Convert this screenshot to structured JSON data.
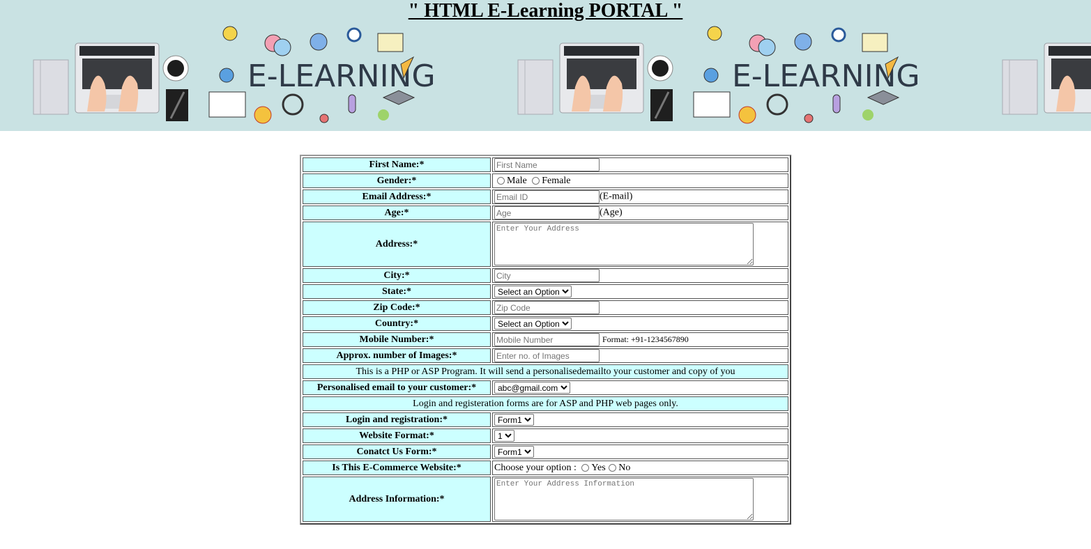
{
  "page": {
    "title": "\" HTML E-Learning PORTAL \"",
    "banner_text": "E-LEARNING"
  },
  "form": {
    "first_name": {
      "label": "First Name:*",
      "placeholder": "First Name"
    },
    "gender": {
      "label": "Gender:*",
      "options": [
        "Male",
        "Female"
      ]
    },
    "email": {
      "label": "Email Address:*",
      "placeholder": "Email ID",
      "hint": "(E-mail)"
    },
    "age": {
      "label": "Age:*",
      "placeholder": "Age",
      "hint": "(Age)"
    },
    "address": {
      "label": "Address:*",
      "placeholder": "Enter Your Address"
    },
    "city": {
      "label": "City:*",
      "placeholder": "City"
    },
    "state": {
      "label": "State:*",
      "selected": "Select an Option"
    },
    "zip": {
      "label": "Zip Code:*",
      "placeholder": "Zip Code"
    },
    "country": {
      "label": "Country:*",
      "selected": "Select an Option"
    },
    "mobile": {
      "label": "Mobile Number:*",
      "placeholder": "Mobile Number",
      "format": "Format: +91-1234567890"
    },
    "images": {
      "label": "Approx. number of Images:*",
      "placeholder": "Enter no. of Images"
    },
    "note_php": "This is a PHP or ASP Program. It will send a personalisedemailto your customer and copy of you",
    "personalised_email": {
      "label": "Personalised email to your customer:*",
      "selected": "abc@gmail.com"
    },
    "note_login": "Login and registeration forms are for ASP and PHP web pages only.",
    "login_registration": {
      "label": "Login and registration:*",
      "selected": "Form1"
    },
    "website_format": {
      "label": "Website Format:*",
      "selected": "1"
    },
    "contact_form": {
      "label": "Conatct Us Form:*",
      "selected": "Form1"
    },
    "ecommerce": {
      "label": "Is This E-Commerce Website:*",
      "prompt": "Choose your option :",
      "options": [
        "Yes",
        "No"
      ]
    },
    "address_info": {
      "label": "Address Information:*",
      "placeholder": "Enter Your Address Information"
    }
  },
  "colors": {
    "label_bg": "#ccffff",
    "banner_bg": "#c9e2e3"
  }
}
